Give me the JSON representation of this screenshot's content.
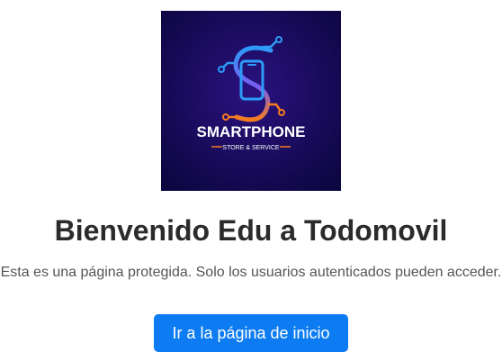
{
  "logo": {
    "brand_name": "SMARTPHONE",
    "tagline": "STORE & SERVICE"
  },
  "welcome": {
    "title": "Bienvenido Edu a Todomovil",
    "message": "Esta es una página protegida. Solo los usuarios autenticados pueden acceder."
  },
  "actions": {
    "home_button_label": "Ir a la página de inicio"
  },
  "colors": {
    "button": "#0d7cf2",
    "logo_background": "#140a52",
    "logo_accent_blue": "#2c9cf8",
    "logo_accent_orange": "#f57c1f"
  }
}
